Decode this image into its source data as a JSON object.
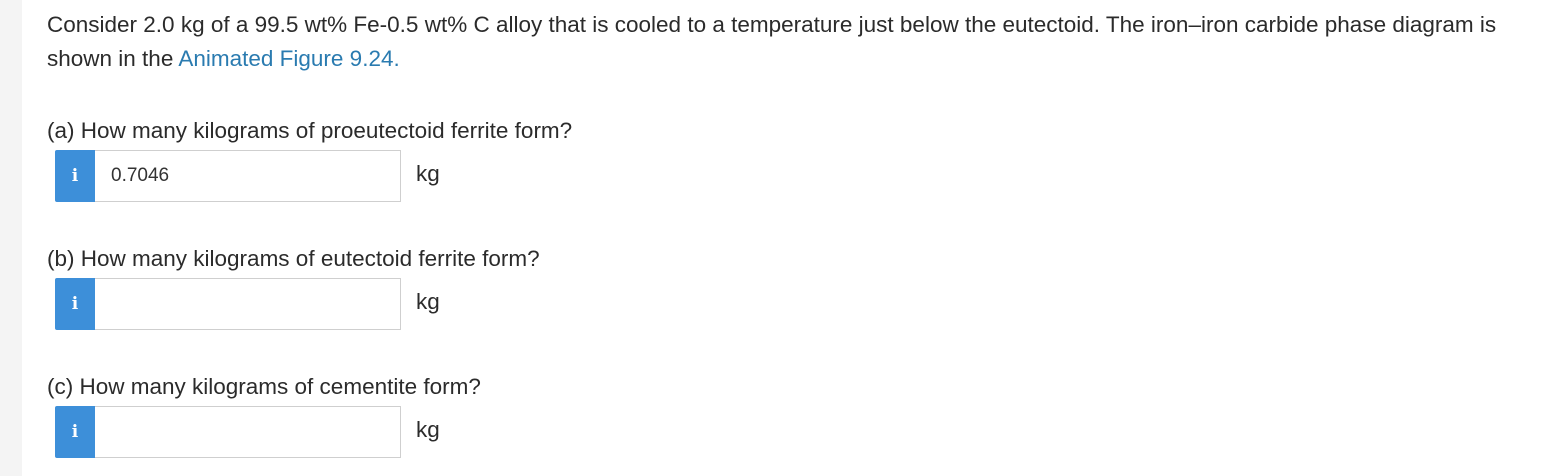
{
  "problem": {
    "statement": "Consider 2.0 kg of a 99.5 wt% Fe-0.5 wt% C alloy that is cooled to a temperature just below the eutectoid. The iron–iron carbide phase diagram is shown in the ",
    "link_text": "Animated Figure 9.24.",
    "link_color": "#2a7bb0"
  },
  "questions": [
    {
      "label": "(a) How many kilograms of proeutectoid ferrite form?",
      "info_icon": "info-icon",
      "value": "0.7046",
      "unit": "kg"
    },
    {
      "label": "(b) How many kilograms of eutectoid ferrite form?",
      "info_icon": "info-icon",
      "value": "",
      "unit": "kg"
    },
    {
      "label": "(c) How many kilograms of cementite form?",
      "info_icon": "info-icon",
      "value": "",
      "unit": "kg"
    }
  ],
  "colors": {
    "info_button": "#3d8fd9",
    "text": "#2b2b2b",
    "background": "#ffffff"
  }
}
